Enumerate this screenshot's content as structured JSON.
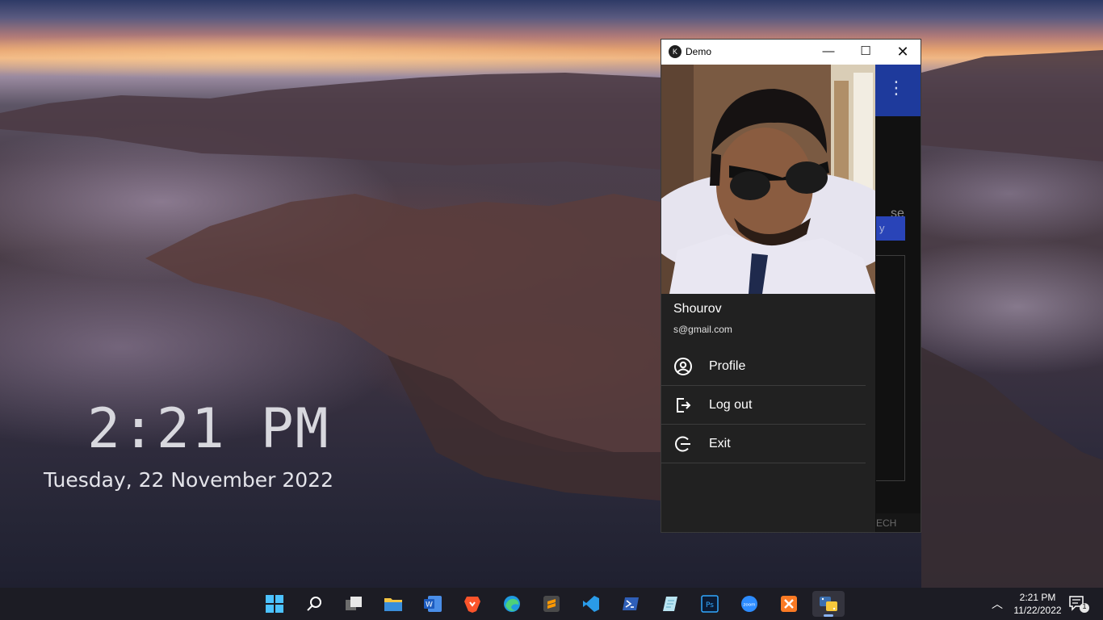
{
  "desktop": {
    "clock_time": "2:21 PM",
    "clock_date": "Tuesday, 22 November 2022"
  },
  "window": {
    "title": "Demo",
    "buttons": {
      "minimize": "—",
      "maximize": "☐",
      "close": "✕"
    }
  },
  "drawer": {
    "user_name": "Shourov",
    "user_email": "s@gmail.com",
    "items": [
      {
        "label": "Profile",
        "icon": "account-circle-icon"
      },
      {
        "label": "Log out",
        "icon": "logout-icon"
      },
      {
        "label": "Exit",
        "icon": "exit-icon"
      }
    ]
  },
  "background_app": {
    "partial_text": "se",
    "partial_button": "y",
    "partial_footer": "ECH",
    "toolbar_color": "#1e3a9c"
  },
  "taskbar": {
    "apps": [
      "start-icon",
      "search-icon",
      "task-view-icon",
      "file-explorer-icon",
      "word-icon",
      "brave-icon",
      "edge-icon",
      "sublime-text-icon",
      "vscode-icon",
      "powershell-icon",
      "notepad-icon",
      "photoshop-icon",
      "zoom-icon",
      "xampp-icon",
      "python-icon"
    ],
    "tray": {
      "time": "2:21 PM",
      "date": "11/22/2022",
      "notification_count": "1"
    }
  }
}
